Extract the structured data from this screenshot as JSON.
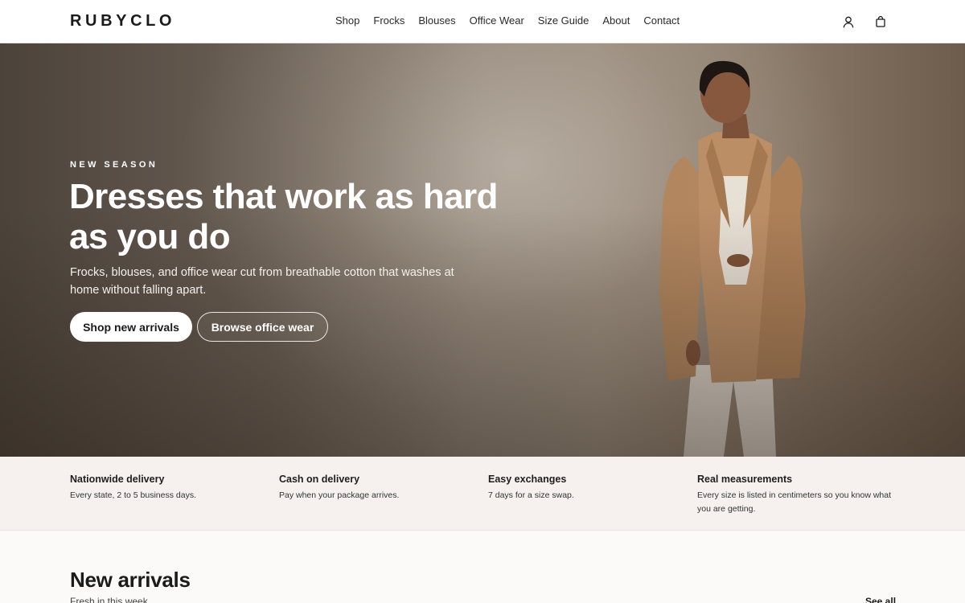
{
  "brand": {
    "logo": "RUBYCLO"
  },
  "nav": {
    "items": [
      {
        "label": "Shop"
      },
      {
        "label": "Frocks"
      },
      {
        "label": "Blouses"
      },
      {
        "label": "Office Wear"
      },
      {
        "label": "Size Guide"
      },
      {
        "label": "About"
      },
      {
        "label": "Contact"
      }
    ]
  },
  "header_icons": {
    "account": "user-icon",
    "bag": "shopping-bag-icon"
  },
  "hero": {
    "eyebrow": "NEW SEASON",
    "title": "Dresses that work as hard as you do",
    "subtitle": "Frocks, blouses, and office wear cut from breathable cotton that washes at home without falling apart.",
    "primary_cta": "Shop new arrivals",
    "secondary_cta": "Browse office wear"
  },
  "perks": [
    {
      "title": "Nationwide delivery",
      "text": "Every state, 2 to 5 business days."
    },
    {
      "title": "Cash on delivery",
      "text": "Pay when your package arrives."
    },
    {
      "title": "Easy exchanges",
      "text": "7 days for a size swap."
    },
    {
      "title": "Real measurements",
      "text": "Every size is listed in centimeters so you know what you are getting."
    }
  ],
  "arrivals": {
    "title": "New arrivals",
    "subtitle": "Fresh in this week",
    "see_all": "See all"
  },
  "colors": {
    "accent": "#1b1b1b",
    "perks_bg": "#f6f1ee",
    "blazer": "#b8895f"
  }
}
